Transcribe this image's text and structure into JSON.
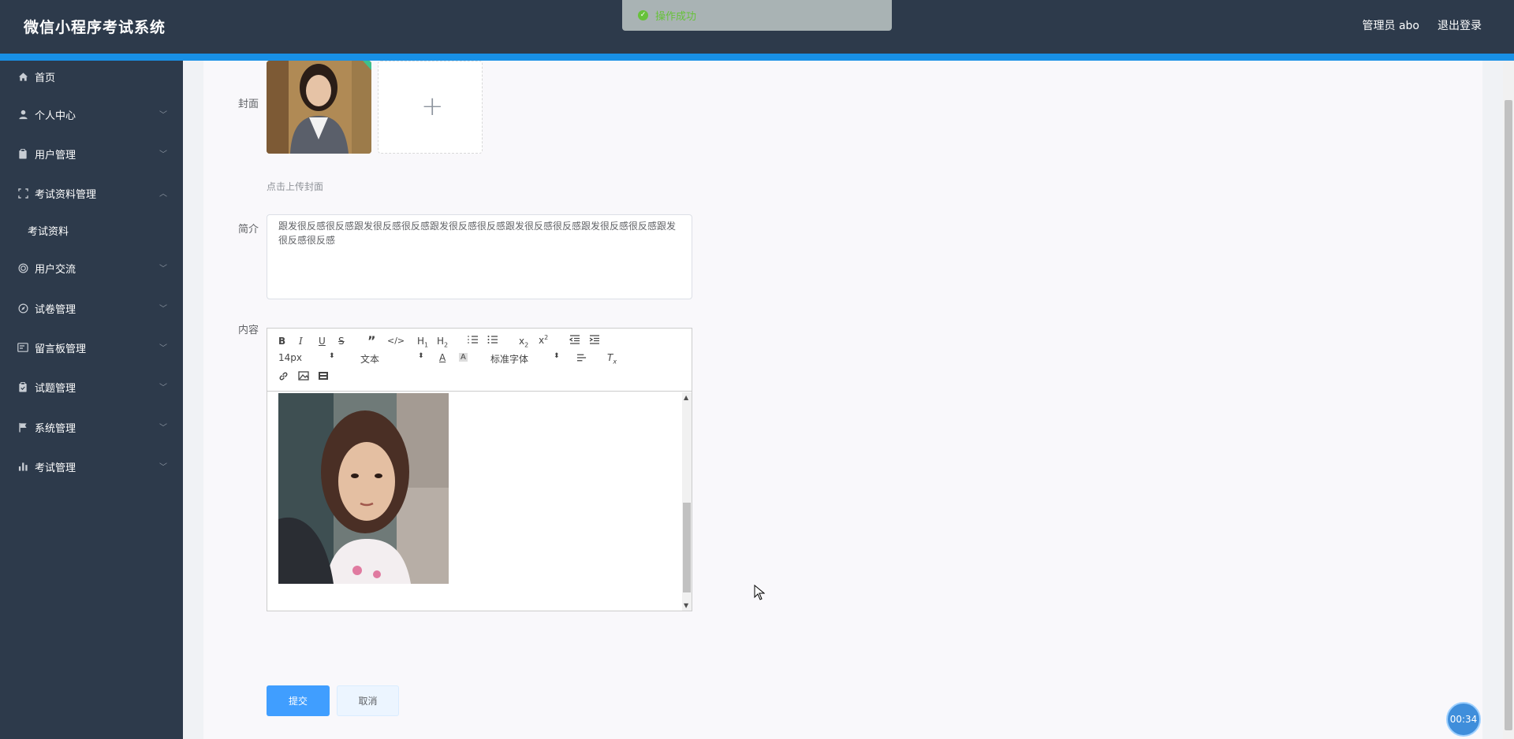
{
  "header": {
    "brand": "微信小程序考试系统",
    "user": "管理员 abo",
    "logout": "退出登录"
  },
  "toast": {
    "message": "操作成功"
  },
  "sidebar": {
    "items": [
      {
        "label": "首页",
        "icon": "home-icon"
      },
      {
        "label": "个人中心",
        "icon": "user-icon"
      },
      {
        "label": "用户管理",
        "icon": "clipboard-icon"
      },
      {
        "label": "考试资料管理",
        "icon": "frame-icon"
      },
      {
        "label": "考试资料",
        "icon": ""
      },
      {
        "label": "用户交流",
        "icon": "chat-icon"
      },
      {
        "label": "试卷管理",
        "icon": "compass-icon"
      },
      {
        "label": "留言板管理",
        "icon": "board-icon"
      },
      {
        "label": "试题管理",
        "icon": "clipboard-check-icon"
      },
      {
        "label": "系统管理",
        "icon": "flag-icon"
      },
      {
        "label": "考试管理",
        "icon": "bar-chart-icon"
      }
    ]
  },
  "form": {
    "cover_label": "封面",
    "cover_hint": "点击上传封面",
    "summary_label": "简介",
    "summary_value": "跟发很反感很反感跟发很反感很反感跟发很反感很反感跟发很反感很反感跟发很反感很反感跟发很反感很反感",
    "content_label": "内容",
    "submit": "提交",
    "cancel": "取消"
  },
  "editor": {
    "font_size": "14px",
    "block_format": "文本",
    "font_family": "标准字体"
  },
  "timer": "00:34"
}
